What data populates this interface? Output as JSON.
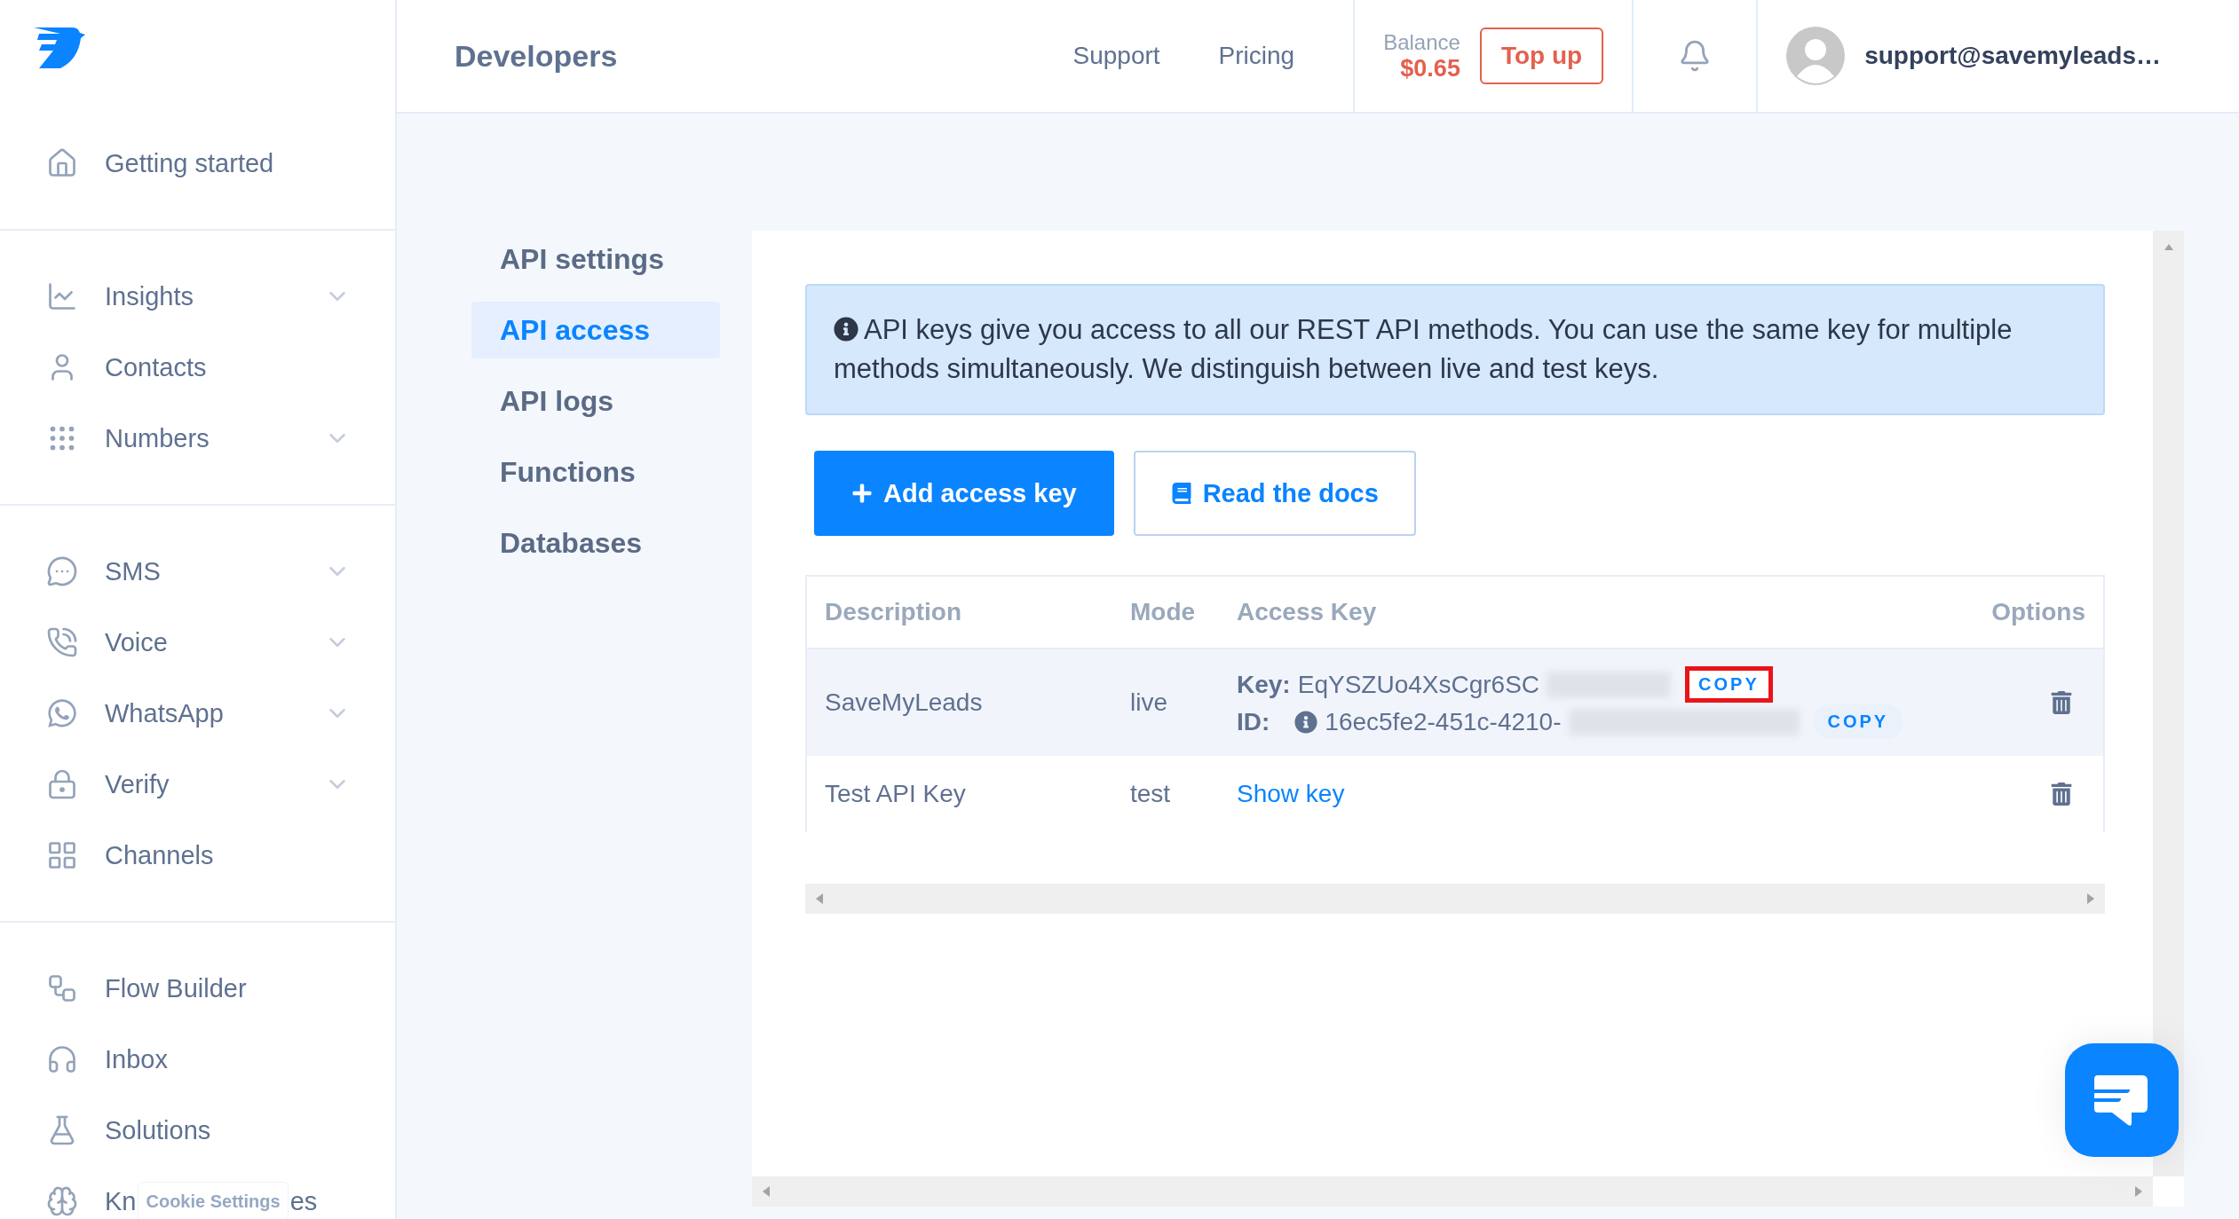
{
  "sidebar": {
    "groups": [
      [
        {
          "label": "Getting started",
          "expandable": false
        }
      ],
      [
        {
          "label": "Insights",
          "expandable": true
        },
        {
          "label": "Contacts",
          "expandable": false
        },
        {
          "label": "Numbers",
          "expandable": true
        }
      ],
      [
        {
          "label": "SMS",
          "expandable": true
        },
        {
          "label": "Voice",
          "expandable": true
        },
        {
          "label": "WhatsApp",
          "expandable": true
        },
        {
          "label": "Verify",
          "expandable": true
        },
        {
          "label": "Channels",
          "expandable": false
        }
      ],
      [
        {
          "label": "Flow Builder",
          "expandable": false
        },
        {
          "label": "Inbox",
          "expandable": false
        },
        {
          "label": "Solutions",
          "expandable": false
        },
        {
          "label": "Kn",
          "label_tail": "es",
          "expandable": false
        }
      ]
    ]
  },
  "cookie_button": {
    "label": "Cookie Settings"
  },
  "header": {
    "title": "Developers",
    "links": [
      "Support",
      "Pricing"
    ],
    "balance": {
      "label": "Balance",
      "amount": "$0.65"
    },
    "top_up": "Top up",
    "user": "support@savemyleads…"
  },
  "subnav": [
    {
      "label": "API settings",
      "selected": false
    },
    {
      "label": "API access",
      "selected": true
    },
    {
      "label": "API logs",
      "selected": false
    },
    {
      "label": "Functions",
      "selected": false
    },
    {
      "label": "Databases",
      "selected": false
    }
  ],
  "info": "API keys give you access to all our REST API methods. You can use the same key for multiple methods simultaneously. We distinguish between live and test keys.",
  "actions": [
    {
      "label": "Add access key",
      "kind": "primary"
    },
    {
      "label": "Read the docs",
      "kind": "secondary"
    }
  ],
  "table": {
    "columns": [
      "Description",
      "Mode",
      "Access Key",
      "Options"
    ],
    "rows": [
      {
        "kind": "key",
        "highlighted": true,
        "description": "SaveMyLeads",
        "mode": "live",
        "key_label": "Key:",
        "key_value": "EqYSZUo4XsCgr6SC",
        "id_label": "ID:",
        "id_value": "16ec5fe2-451c-4210-",
        "copy_buttons": [
          {
            "label": "COPY",
            "marked": true
          },
          {
            "label": "COPY",
            "marked": false
          }
        ]
      },
      {
        "kind": "hidden",
        "highlighted": false,
        "description": "Test API Key",
        "mode": "test",
        "link": "Show key"
      }
    ]
  }
}
